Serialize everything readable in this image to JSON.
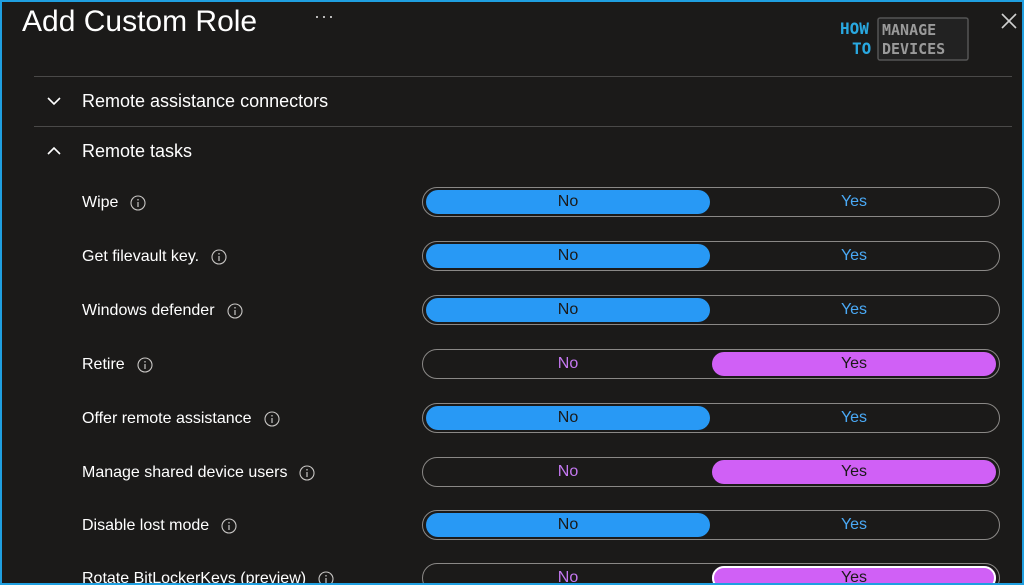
{
  "header": {
    "title": "Add Custom Role",
    "more_label": "···",
    "logo": {
      "line1_left": "HOW",
      "line2_left": "TO",
      "line1_right": "MANAGE",
      "line2_right": "DEVICES"
    }
  },
  "sections": [
    {
      "label": "Remote assistance connectors",
      "state": "collapsed"
    },
    {
      "label": "Remote tasks",
      "state": "expanded"
    }
  ],
  "permissions": [
    {
      "label": "Wipe",
      "value": "No",
      "no_label": "No",
      "yes_label": "Yes"
    },
    {
      "label": "Get filevault key.",
      "value": "No",
      "no_label": "No",
      "yes_label": "Yes"
    },
    {
      "label": "Windows defender",
      "value": "No",
      "no_label": "No",
      "yes_label": "Yes"
    },
    {
      "label": "Retire",
      "value": "Yes",
      "no_label": "No",
      "yes_label": "Yes"
    },
    {
      "label": "Offer remote assistance",
      "value": "No",
      "no_label": "No",
      "yes_label": "Yes"
    },
    {
      "label": "Manage shared device users",
      "value": "Yes",
      "no_label": "No",
      "yes_label": "Yes"
    },
    {
      "label": "Disable lost mode",
      "value": "No",
      "no_label": "No",
      "yes_label": "Yes"
    },
    {
      "label": "Rotate BitLockerKeys (preview)",
      "value": "Yes",
      "no_label": "No",
      "yes_label": "Yes"
    }
  ],
  "colors": {
    "accent_blue": "#2899f5",
    "accent_pink": "#d060f6",
    "background": "#1b1a19",
    "frame_border": "#1f9fe0"
  }
}
